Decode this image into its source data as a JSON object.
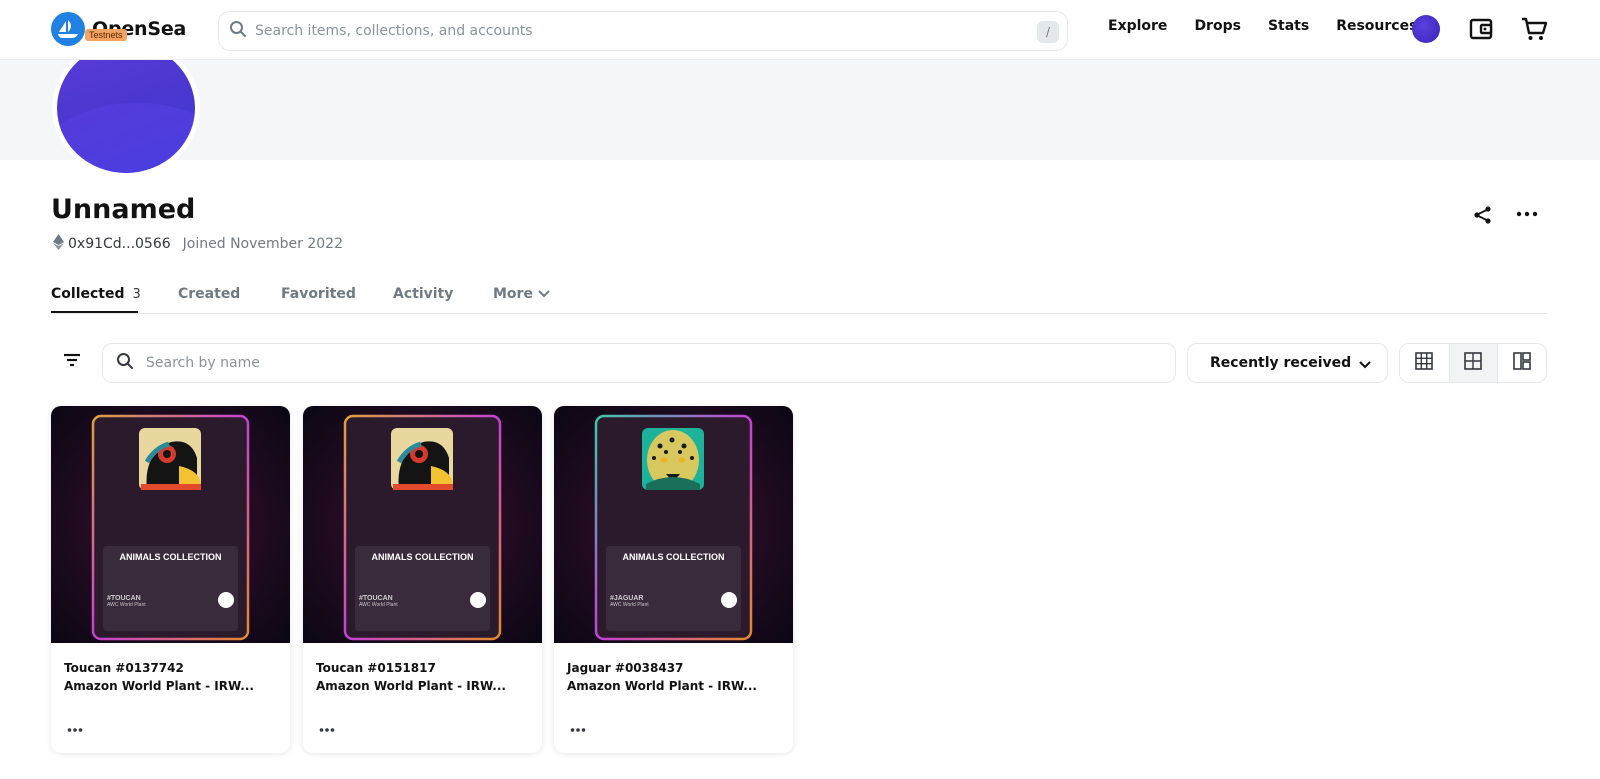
{
  "header": {
    "brand": "OpenSea",
    "badge": "Testnets",
    "search_placeholder": "Search items, collections, and accounts",
    "search_shortcut": "/",
    "nav_links": [
      "Explore",
      "Drops",
      "Stats",
      "Resources"
    ]
  },
  "profile": {
    "name": "Unnamed",
    "address": "0x91Cd...0566",
    "joined": "Joined November 2022"
  },
  "tabs": [
    {
      "label": "Collected",
      "count": "3"
    },
    {
      "label": "Created"
    },
    {
      "label": "Favorited"
    },
    {
      "label": "Activity"
    },
    {
      "label": "More"
    }
  ],
  "filters": {
    "name_search_placeholder": "Search by name",
    "sort_label": "Recently received"
  },
  "items": [
    {
      "title": "Toucan #0137742",
      "collection": "Amazon World Plant - IRW...",
      "card_heading": "ANIMALS COLLECTION",
      "card_tag": "#TOUCAN",
      "card_subtag": "AWC World Plant",
      "art": "toucan"
    },
    {
      "title": "Toucan #0151817",
      "collection": "Amazon World Plant - IRW...",
      "card_heading": "ANIMALS COLLECTION",
      "card_tag": "#TOUCAN",
      "card_subtag": "AWC World Plant",
      "art": "toucan"
    },
    {
      "title": "Jaguar #0038437",
      "collection": "Amazon World Plant - IRW...",
      "card_heading": "ANIMALS COLLECTION",
      "card_tag": "#JAGUAR",
      "card_subtag": "AWC World Plant",
      "art": "jaguar"
    }
  ],
  "colors": {
    "brand_blue": "#2081e2",
    "badge_orange": "#f4a261",
    "avatar_purple": "#4a37d0"
  }
}
